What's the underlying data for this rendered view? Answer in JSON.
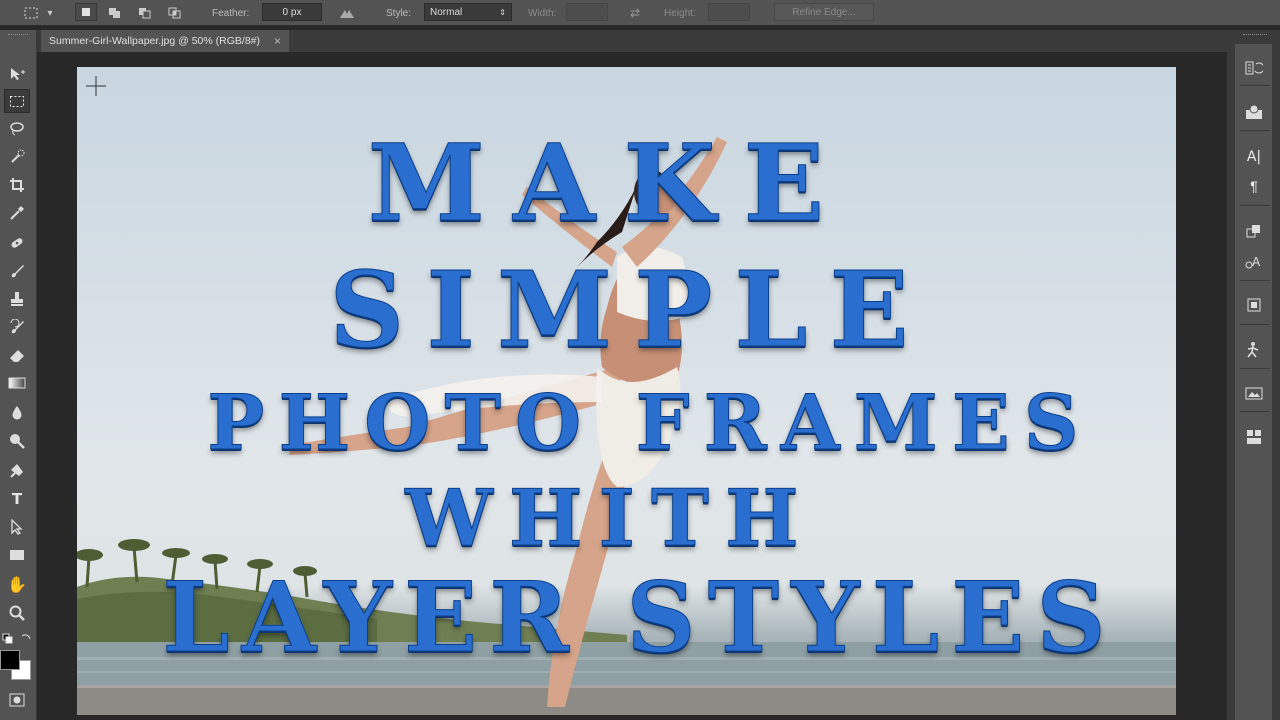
{
  "options_bar": {
    "feather_label": "Feather:",
    "feather_value": "0 px",
    "style_label": "Style:",
    "style_value": "Normal",
    "width_label": "Width:",
    "height_label": "Height:",
    "refine_edge_label": "Refine Edge..."
  },
  "document": {
    "tab_title": "Summer-Girl-Wallpaper.jpg @ 50% (RGB/8#)",
    "close_glyph": "×"
  },
  "overlay_text": {
    "line1": "MAKE",
    "line2": "SIMPLE",
    "line3": "PHOTO FRAMES",
    "line4": "WHITH",
    "line5": "LAYER STYLES"
  },
  "colors": {
    "ui_panel": "#535353",
    "ui_dark": "#282828",
    "title_blue": "#2a6fd0",
    "title_outline": "#0b3f8a"
  },
  "tools": [
    "move-icon",
    "marquee-icon",
    "lasso-icon",
    "quick-select-icon",
    "crop-icon",
    "eyedropper-icon",
    "healing-icon",
    "brush-icon",
    "stamp-icon",
    "history-brush-icon",
    "eraser-icon",
    "gradient-icon",
    "blur-icon",
    "dodge-icon",
    "pen-icon",
    "type-icon",
    "path-select-icon",
    "shape-icon",
    "hand-icon",
    "zoom-icon"
  ],
  "right_panel_icons": [
    "history-icon",
    "properties-icon",
    "character-icon",
    "paragraph-icon",
    "clone-source-icon",
    "character-styles-icon",
    "transform-icon",
    "actions-icon",
    "layer-comps-icon",
    "layers-icon"
  ]
}
